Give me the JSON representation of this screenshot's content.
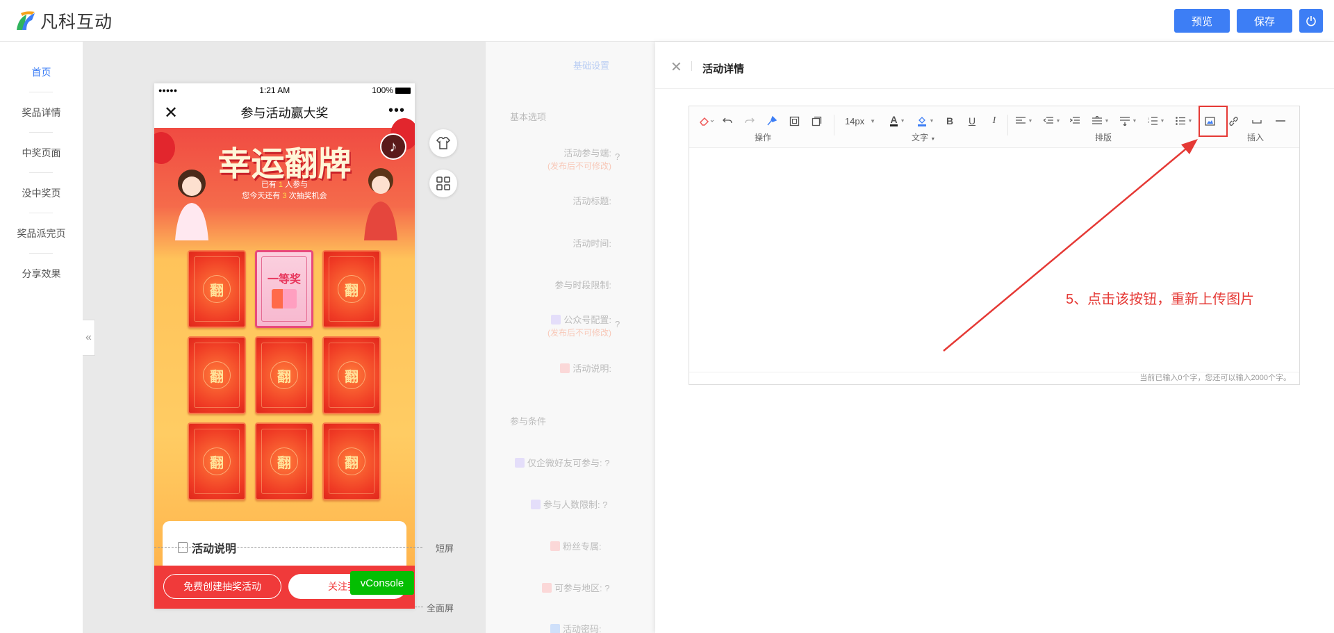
{
  "brand": {
    "name": "凡科互动",
    "colors": {
      "accent": "#3d7ef5",
      "green": "#2fb35d",
      "orange": "#f6a21a",
      "danger": "#e53935"
    }
  },
  "topbar": {
    "preview_label": "预览",
    "save_label": "保存",
    "power_icon": "power-icon"
  },
  "nav": {
    "items": [
      {
        "label": "首页",
        "active": true
      },
      {
        "label": "奖品详情"
      },
      {
        "label": "中奖页面"
      },
      {
        "label": "没中奖页"
      },
      {
        "label": "奖品派完页"
      },
      {
        "label": "分享效果"
      }
    ],
    "collapse_icon": "«"
  },
  "phone": {
    "status": {
      "signal": "●●●●●",
      "time": "1:21 AM",
      "battery": "100%"
    },
    "nav_title": "参与活动赢大奖",
    "close_icon": "✕",
    "more_icon": "•••",
    "banner_title": "幸运翻牌",
    "banner_line1_prefix": "已有",
    "banner_line1_count": "1",
    "banner_line1_suffix": "人参与",
    "banner_line2_prefix": "您今天还有",
    "banner_line2_count": "3",
    "banner_line2_suffix": "次抽奖机会",
    "music_icon": "♪",
    "card_glyph": "翻",
    "prize_label": "一等奖",
    "info_title": "活动说明",
    "create_button": "免费创建抽奖活动",
    "follow_button": "关注我们",
    "vconsole": "vConsole"
  },
  "canvas": {
    "short_screen": "短屏",
    "full_screen": "全面屏"
  },
  "settings": {
    "tab": "基础设置",
    "section1": "基本选项",
    "fields": [
      {
        "label": "活动参与端:",
        "warn": "(发布后不可修改)"
      },
      {
        "label": "活动标题:"
      },
      {
        "label": "活动时间:"
      },
      {
        "label": "参与时段限制:"
      },
      {
        "label": "公众号配置:",
        "warn": "(发布后不可修改)"
      },
      {
        "label": "活动说明:"
      }
    ],
    "section2": "参与条件",
    "fields2": [
      {
        "label": "仅企微好友可参与:"
      },
      {
        "label": "参与人数限制:"
      },
      {
        "label": "粉丝专属:"
      },
      {
        "label": "可参与地区:"
      },
      {
        "label": "活动密码:"
      }
    ]
  },
  "drawer": {
    "title": "活动详情",
    "close_icon": "✕",
    "toolbar": {
      "font_size": "14px",
      "group_ops": "操作",
      "group_text": "文字",
      "group_layout": "排版",
      "group_insert": "插入"
    },
    "counter": "当前已输入0个字，您还可以输入2000个字。"
  },
  "annotation": "5、点击该按钮，重新上传图片"
}
